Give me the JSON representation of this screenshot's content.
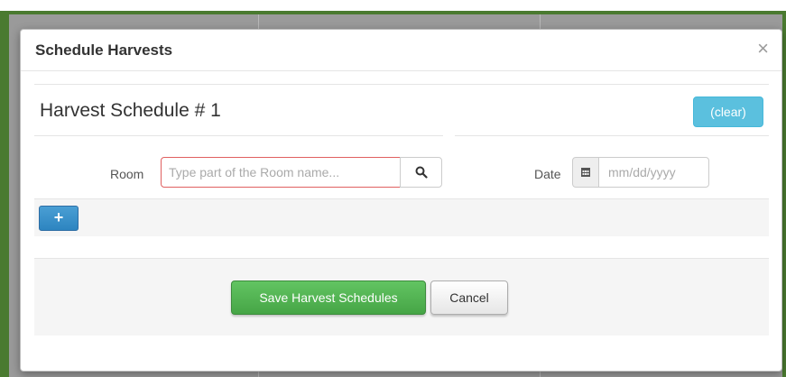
{
  "modal": {
    "title": "Schedule Harvests",
    "close_label": "×"
  },
  "schedule": {
    "title": "Harvest Schedule # 1",
    "clear_label": "(clear)",
    "room_label": "Room",
    "room_placeholder": "Type part of the Room name...",
    "room_value": "",
    "search_icon": "search-icon",
    "date_label": "Date",
    "date_icon": "calendar-icon",
    "date_placeholder": "mm/dd/yyyy",
    "date_value": "",
    "add_label": "+"
  },
  "footer": {
    "save_label": "Save Harvest Schedules",
    "cancel_label": "Cancel"
  },
  "colors": {
    "info": "#5bc0de",
    "success": "#46a546",
    "primary": "#337ab7",
    "error_border": "#e06060",
    "frame_green": "#4a7a30"
  }
}
